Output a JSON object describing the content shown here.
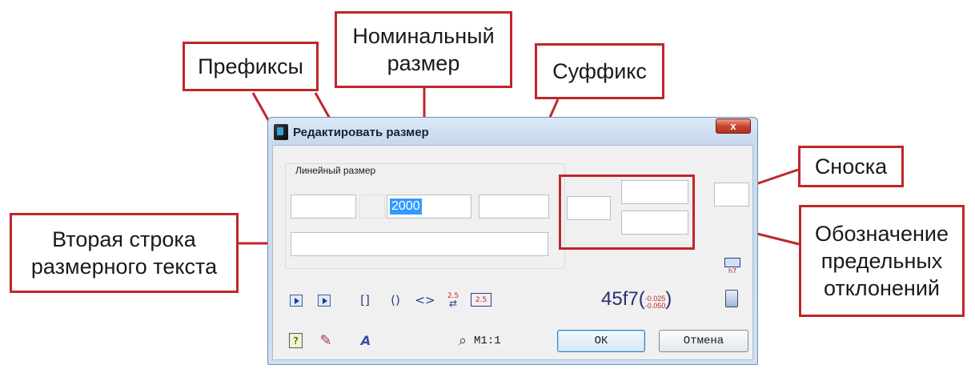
{
  "callouts": {
    "prefixes": "Префиксы",
    "nominal_line1": "Номинальный",
    "nominal_line2": "размер",
    "suffix": "Суффикс",
    "footnote": "Сноска",
    "second_line_line1": "Вторая строка",
    "second_line_line2": "размерного текста",
    "tolerance_line1": "Обозначение",
    "tolerance_line2": "предельных",
    "tolerance_line3": "отклонений"
  },
  "dialog": {
    "title": "Редактировать размер",
    "close_label": "x",
    "group_label": "Линейный размер",
    "fields": {
      "prefix1": "",
      "prefix2": "",
      "nominal": "2000",
      "suffix": "",
      "tolerance_qualifier": "",
      "tolerance_upper": "",
      "tolerance_lower": "",
      "footnote": "",
      "second_line": ""
    },
    "toolbar": {
      "symbols": [
        "[]",
        "()",
        "<>"
      ],
      "fraction_label": "2.5",
      "box_label": "2.5",
      "tolerance_value": "45f7",
      "tolerance_upper_dev": "-0.025",
      "tolerance_lower_dev": "-0.050",
      "table_icon_label": "h7"
    },
    "scale_label": "М1:1",
    "ok_label": "ОК",
    "cancel_label": "Отмена"
  },
  "colors": {
    "callout_border": "#c0262b",
    "selection": "#3399ff",
    "dialog_bg": "#f0f0f0"
  }
}
